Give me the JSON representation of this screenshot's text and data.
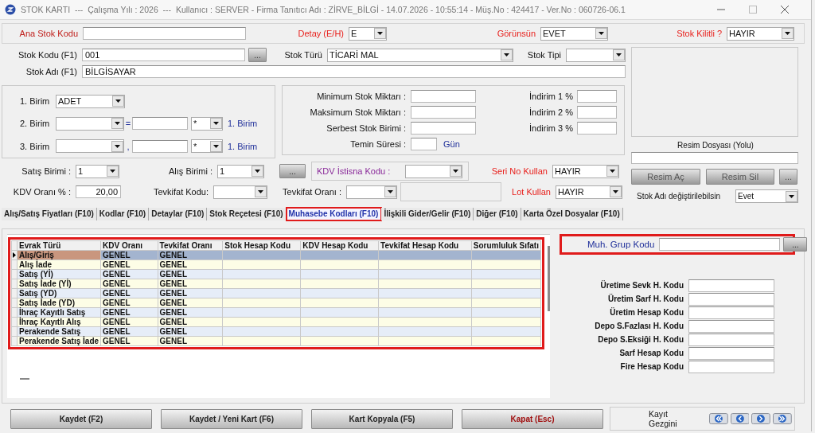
{
  "window": {
    "title": "STOK KARTI  ---  Çalışma Yılı : 2026  ---  Kullanıcı : SERVER - Firma Tanıtıcı Adı : ZİRVE_BİLGİ - 14.07.2026 - 10:55:14 - Müş.No : 424417 - Ver.No : 060726-06.1"
  },
  "header": {
    "ana_stok_kodu": {
      "label": "Ana Stok Kodu"
    },
    "detay": {
      "label": "Detay (E/H)",
      "value": "E"
    },
    "gorunsun": {
      "label": "Görünsün",
      "value": "EVET"
    },
    "stok_kilitli": {
      "label": "Stok Kilitli ?",
      "value": "HAYIR"
    }
  },
  "stock": {
    "stok_kodu": {
      "label": "Stok Kodu (F1)",
      "value": "001",
      "button": "..."
    },
    "stok_turu": {
      "label": "Stok Türü",
      "value": "TİCARİ MAL"
    },
    "stok_tipi": {
      "label": "Stok Tipi"
    },
    "stok_adi": {
      "label": "Stok Adı (F1)",
      "value": "BİLGİSAYAR"
    }
  },
  "units": [
    {
      "label": "1. Birim",
      "value": "ADET"
    },
    {
      "label": "2. Birim",
      "separator": "=",
      "multiplier": "*",
      "suffix": "1. Birim"
    },
    {
      "label": "3. Birim",
      "separator": ",",
      "multiplier": "*",
      "suffix": "1. Birim"
    }
  ],
  "limits": [
    {
      "label": "Minimum Stok Miktarı :"
    },
    {
      "label": "Maksimum Stok Miktarı :"
    },
    {
      "label": "Serbest Stok Birimi :"
    },
    {
      "label": "Temin Süresi :",
      "unit": "Gün"
    }
  ],
  "discounts": [
    {
      "label": "İndirim 1 %"
    },
    {
      "label": "İndirim 2 %"
    },
    {
      "label": "İndirim 3 %"
    }
  ],
  "image": {
    "caption": "Resim Dosyası (Yolu)",
    "buttons": [
      "Resim Aç",
      "Resim Sil",
      "..."
    ]
  },
  "sales": {
    "satis_birimi": {
      "label": "Satış Birimi :",
      "value": "1"
    },
    "alis_birimi": {
      "label": "Alış Birimi :",
      "value": "1"
    },
    "button": "...",
    "kdv_istisna": {
      "label": "KDV İstisna Kodu :"
    },
    "seri_no": {
      "label": "Seri No Kullan",
      "value": "HAYIR"
    }
  },
  "tax": {
    "kdv_orani": {
      "label": "KDV Oranı % :",
      "value": "20,00"
    },
    "tevkifat_kodu": {
      "label": "Tevkifat Kodu:"
    },
    "tevkifat_orani": {
      "label": "Tevkifat Oranı :"
    },
    "lot": {
      "label": "Lot Kullan",
      "value": "HAYIR"
    },
    "stok_adi_degis": {
      "label": "Stok Adı değiştirilebilsin",
      "value": "Evet"
    }
  },
  "tabs": [
    {
      "label": "Alış/Satış Fiyatları (F10)",
      "selected": false,
      "highlighted": false
    },
    {
      "label": "Kodlar (F10)",
      "selected": false,
      "highlighted": false
    },
    {
      "label": "Detaylar  (F10)",
      "selected": false,
      "highlighted": false
    },
    {
      "label": "Stok Reçetesi  (F10)",
      "selected": false,
      "highlighted": false
    },
    {
      "label": "Muhasebe Kodları (F10)",
      "selected": true,
      "highlighted": true
    },
    {
      "label": "İlişkili Gider/Gelir  (F10)",
      "selected": false,
      "highlighted": false
    },
    {
      "label": "Diğer (F10)",
      "selected": false,
      "highlighted": false
    },
    {
      "label": "Karta Özel Dosyalar (F10)",
      "selected": false,
      "highlighted": false
    }
  ],
  "grid": {
    "highlighted": true,
    "columns": [
      "Evrak Türü",
      "KDV Oranı",
      "Tevkifat Oranı",
      "Stok Hesap Kodu",
      "KDV Hesap Kodu",
      "Tevkifat Hesap Kodu",
      "Sorumluluk Sıfatı"
    ],
    "rows": [
      {
        "cells": [
          "Alış/Giriş",
          "GENEL",
          "GENEL"
        ],
        "selected": true
      },
      {
        "cells": [
          "Alış İade",
          "GENEL",
          "GENEL"
        ],
        "selected": false
      },
      {
        "cells": [
          "Satış (Yİ)",
          "GENEL",
          "GENEL"
        ],
        "selected": false
      },
      {
        "cells": [
          "Satış İade (Yİ)",
          "GENEL",
          "GENEL"
        ],
        "selected": false
      },
      {
        "cells": [
          "Satış (YD)",
          "GENEL",
          "GENEL"
        ],
        "selected": false
      },
      {
        "cells": [
          "Satış İade (YD)",
          "GENEL",
          "GENEL"
        ],
        "selected": false
      },
      {
        "cells": [
          "İhraç Kayıtlı Satış",
          "GENEL",
          "GENEL"
        ],
        "selected": false
      },
      {
        "cells": [
          "İhraç Kayıtlı Alış",
          "GENEL",
          "GENEL"
        ],
        "selected": false
      },
      {
        "cells": [
          "Perakende Satış",
          "GENEL",
          "GENEL"
        ],
        "selected": false
      },
      {
        "cells": [
          "Perakende Satış İade",
          "GENEL",
          "GENEL"
        ],
        "selected": false
      }
    ]
  },
  "accounting": {
    "group": {
      "label": "Muh. Grup Kodu",
      "button": "...",
      "highlighted": true
    },
    "fields": [
      {
        "label": "Üretime Sevk H. Kodu"
      },
      {
        "label": "Üretim Sarf H. Kodu"
      },
      {
        "label": "Üretim Hesap Kodu"
      },
      {
        "label": "Depo S.Fazlası H. Kodu"
      },
      {
        "label": "Depo S.Eksiği H. Kodu"
      },
      {
        "label": "Sarf Hesap Kodu"
      },
      {
        "label": "Fire Hesap Kodu"
      }
    ]
  },
  "footer": {
    "buttons": [
      {
        "label": "Kaydet (F2)",
        "kind": "normal"
      },
      {
        "label": "Kaydet / Yeni Kart (F6)",
        "kind": "normal"
      },
      {
        "label": "Kart Kopyala (F5)",
        "kind": "normal"
      },
      {
        "label": "Kapat (Esc)",
        "kind": "danger"
      }
    ],
    "navigator": {
      "label": "Kayıt Gezgini"
    }
  }
}
